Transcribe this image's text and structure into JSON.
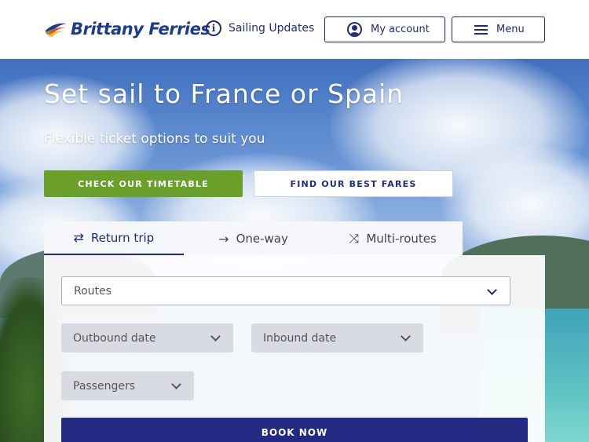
{
  "header": {
    "brand": "Brittany Ferries",
    "sailing_updates": "Sailing Updates",
    "my_account": "My account",
    "menu": "Menu"
  },
  "hero": {
    "title": "Set sail to France or Spain",
    "subtitle": "Flexible ticket options to suit you",
    "cta_timetable": "CHECK OUR TIMETABLE",
    "cta_fares": "FIND OUR BEST FARES"
  },
  "booking": {
    "tabs": [
      {
        "label": "Return trip",
        "icon": "swap-arrows-icon",
        "active": true
      },
      {
        "label": "One-way",
        "icon": "arrow-right-icon",
        "active": false
      },
      {
        "label": "Multi-routes",
        "icon": "multi-route-icon",
        "active": false
      }
    ],
    "routes_placeholder": "Routes",
    "outbound_placeholder": "Outbound date",
    "inbound_placeholder": "Inbound date",
    "passengers_placeholder": "Passengers",
    "book_now": "BOOK NOW"
  },
  "colors": {
    "brand_navy": "#1f2c7d",
    "timetable_green": "#6a9f2a",
    "book_button": "#232a84"
  }
}
